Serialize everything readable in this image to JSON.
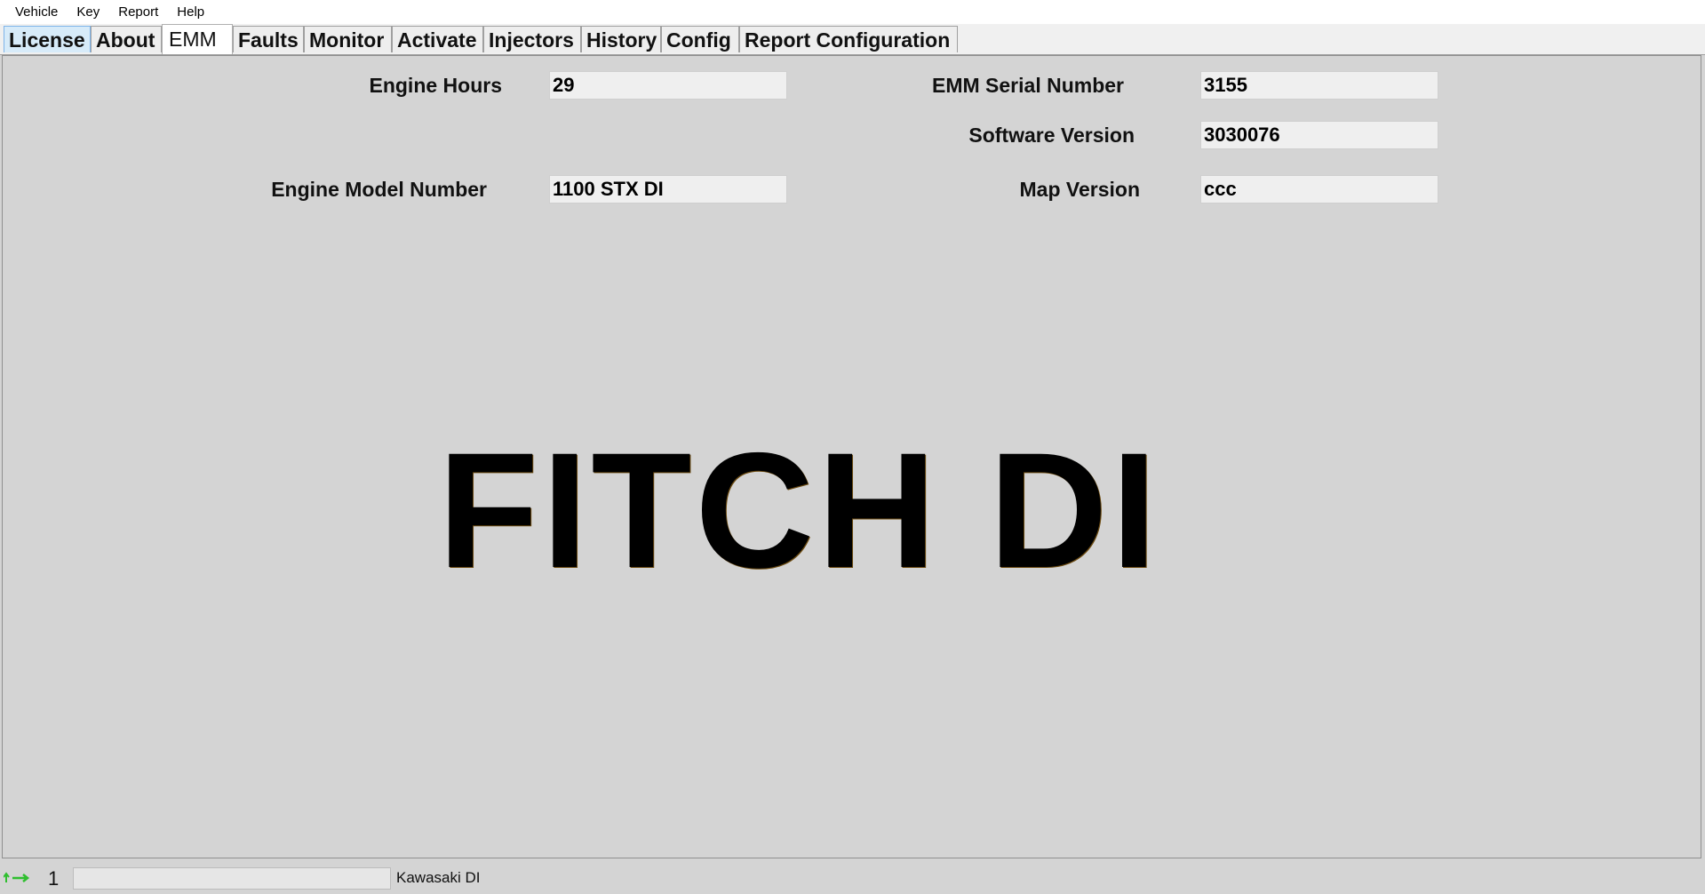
{
  "menu": {
    "items": [
      "Vehicle",
      "Key",
      "Report",
      "Help"
    ]
  },
  "tabs": {
    "items": [
      "License",
      "About",
      "EMM",
      "Faults",
      "Monitor",
      "Activate",
      "Injectors",
      "History",
      "Config",
      "Report Configuration"
    ],
    "active": "EMM"
  },
  "emm": {
    "engine_hours": {
      "label": "Engine Hours",
      "value": "29"
    },
    "serial_number": {
      "label": "EMM Serial Number",
      "value": "3155"
    },
    "software_version": {
      "label": "Software Version",
      "value": "3030076"
    },
    "model_number": {
      "label": "Engine Model Number",
      "value": "1100 STX DI"
    },
    "map_version": {
      "label": "Map Version",
      "value": "ccc"
    },
    "banner": "FITCH DI"
  },
  "status": {
    "count": "1",
    "progress": 0,
    "vehicle": "Kawasaki DI",
    "icon": "connection-arrows-icon"
  },
  "colors": {
    "background": "#d4d4d4",
    "tab_selected_bg": "#ffffff",
    "tab_hover_bg": "#d7ebf9",
    "status_icon": "#2fbf2f"
  }
}
